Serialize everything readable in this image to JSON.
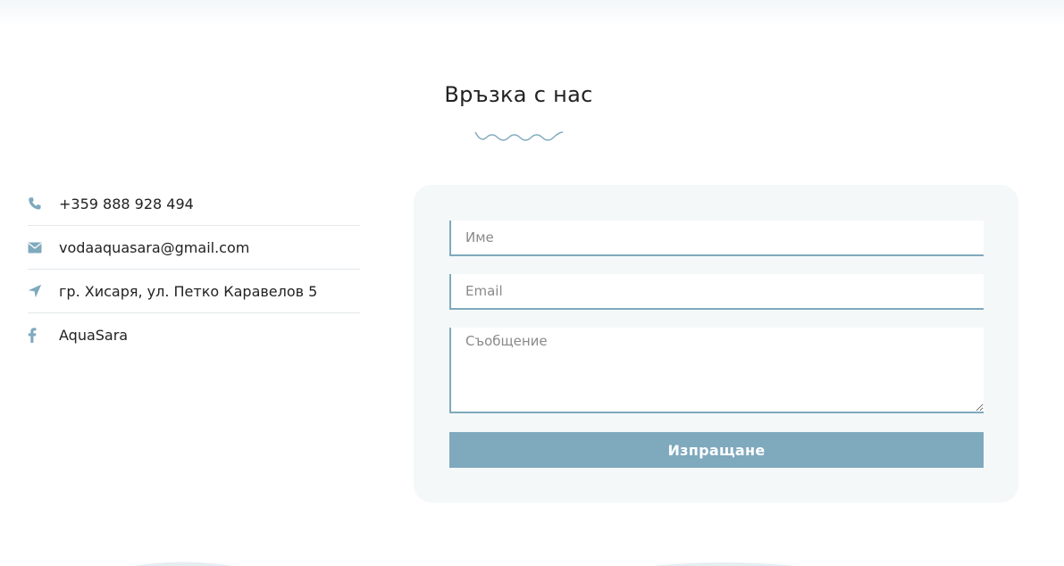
{
  "page": {
    "title": "Връзка с нас"
  },
  "contact": {
    "items": [
      {
        "icon": "phone-icon",
        "text": "+359 888 928 494"
      },
      {
        "icon": "envelope-icon",
        "text": "vodaaquasara@gmail.com"
      },
      {
        "icon": "location-arrow-icon",
        "text": "гр. Хисаря, ул. Петко Каравелов 5"
      },
      {
        "icon": "facebook-icon",
        "text": "AquaSara"
      }
    ]
  },
  "form": {
    "name_placeholder": "Име",
    "email_placeholder": "Email",
    "message_placeholder": "Съобщение",
    "submit_label": "Изпращане"
  },
  "colors": {
    "accent": "#7fa9bd",
    "card_background": "#f4f8f9",
    "text": "#222222"
  }
}
